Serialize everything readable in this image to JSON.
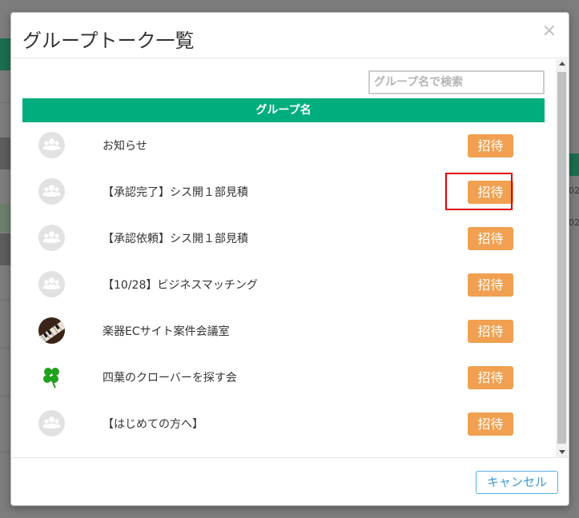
{
  "modal": {
    "title": "グループトーク一覧",
    "close_symbol": "×",
    "search": {
      "placeholder": "グループ名で検索",
      "value": ""
    },
    "table_header": "グループ名",
    "invite_label": "招待",
    "cancel_label": "キャンセル",
    "groups": [
      {
        "name": "お知らせ",
        "avatar": "group-icon",
        "highlighted": true
      },
      {
        "name": "【承認完了】シス開１部見積",
        "avatar": "group-icon"
      },
      {
        "name": "【承認依頼】シス開１部見積",
        "avatar": "group-icon"
      },
      {
        "name": "【10/28】ビジネスマッチング",
        "avatar": "group-icon"
      },
      {
        "name": "楽器ECサイト案件会議室",
        "avatar": "piano-image"
      },
      {
        "name": "四葉のクローバーを探す会",
        "avatar": "clover-icon"
      },
      {
        "name": "【はじめての方へ】",
        "avatar": "group-icon"
      }
    ]
  },
  "colors": {
    "header_green": "#00ad7c",
    "invite_orange": "#f0a050",
    "highlight_red": "#e00000",
    "cancel_blue": "#3b9bd6"
  },
  "background": {
    "right_text": [
      "02",
      "02"
    ]
  }
}
